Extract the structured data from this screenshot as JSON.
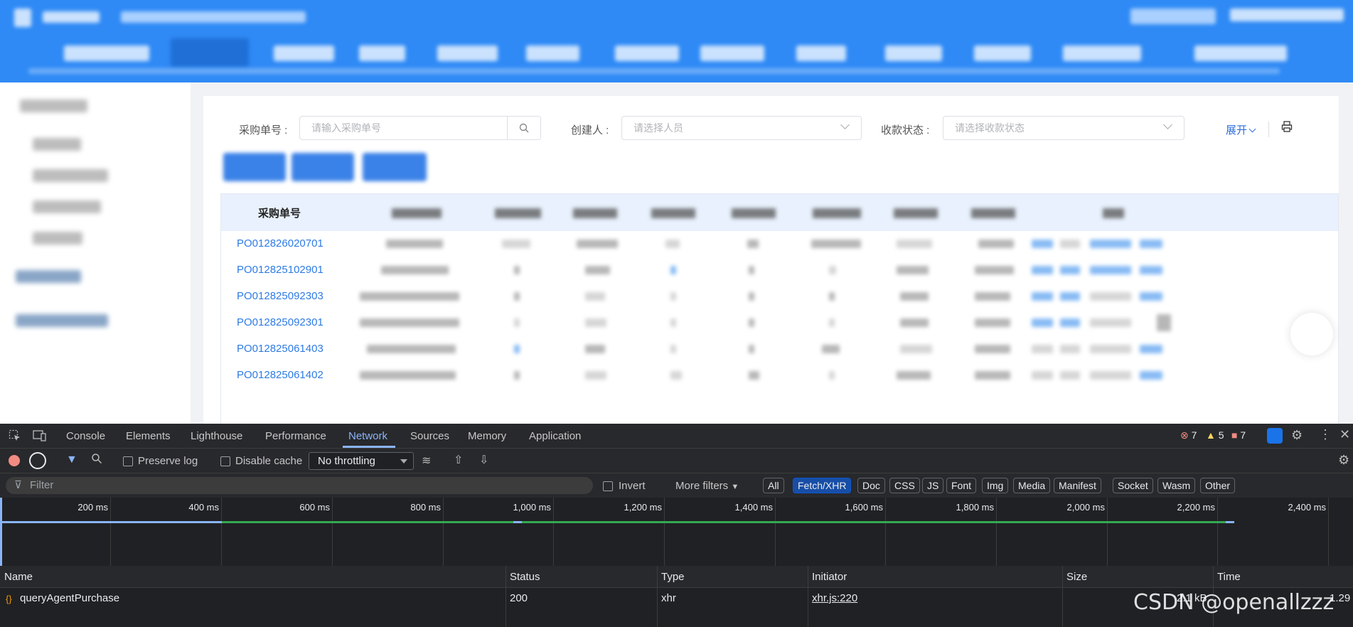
{
  "search_form": {
    "po_label": "采购单号 :",
    "po_placeholder": "请输入采购单号",
    "creator_label": "创建人 :",
    "creator_placeholder": "请选择人员",
    "payment_status_label": "收款状态 :",
    "payment_status_placeholder": "请选择收款状态",
    "expand_label": "展开",
    "search_icon": "search-icon",
    "print_icon": "printer-icon"
  },
  "table": {
    "first_column_header": "采购单号",
    "rows": [
      {
        "po_number": "PO012826020701"
      },
      {
        "po_number": "PO012825102901"
      },
      {
        "po_number": "PO012825092303"
      },
      {
        "po_number": "PO012825092301"
      },
      {
        "po_number": "PO012825061403"
      },
      {
        "po_number": "PO012825061402"
      }
    ]
  },
  "devtools": {
    "tabs": [
      "Console",
      "Elements",
      "Lighthouse",
      "Performance",
      "Network",
      "Sources",
      "Memory",
      "Application"
    ],
    "active_tab": "Network",
    "badges": {
      "errors": "7",
      "warnings": "5",
      "issues": "7"
    },
    "toolbar": {
      "preserve_log": "Preserve log",
      "disable_cache": "Disable cache",
      "throttling": "No throttling"
    },
    "filter": {
      "placeholder": "Filter",
      "invert": "Invert",
      "more_filters": "More filters",
      "type_chips": [
        "All",
        "Fetch/XHR",
        "Doc",
        "CSS",
        "JS",
        "Font",
        "Img",
        "Media",
        "Manifest",
        "Socket",
        "Wasm",
        "Other"
      ],
      "active_chip": "Fetch/XHR"
    },
    "timeline_ticks": [
      "200 ms",
      "400 ms",
      "600 ms",
      "800 ms",
      "1,000 ms",
      "1,200 ms",
      "1,400 ms",
      "1,600 ms",
      "1,800 ms",
      "2,000 ms",
      "2,200 ms",
      "2,400 ms"
    ],
    "columns": [
      "Name",
      "Status",
      "Type",
      "Initiator",
      "Size",
      "Time"
    ],
    "requests": [
      {
        "name": "queryAgentPurchase",
        "status": "200",
        "type": "xhr",
        "initiator": "xhr.js:220",
        "size": "2.1 kB",
        "time": "1.29"
      }
    ]
  },
  "watermark": "CSDN @openallzzz",
  "colors": {
    "header_blue": "#2f8af5",
    "link_blue": "#2d7be5",
    "devtools_bg": "#202124",
    "devtools_active": "#8ab4f8"
  }
}
